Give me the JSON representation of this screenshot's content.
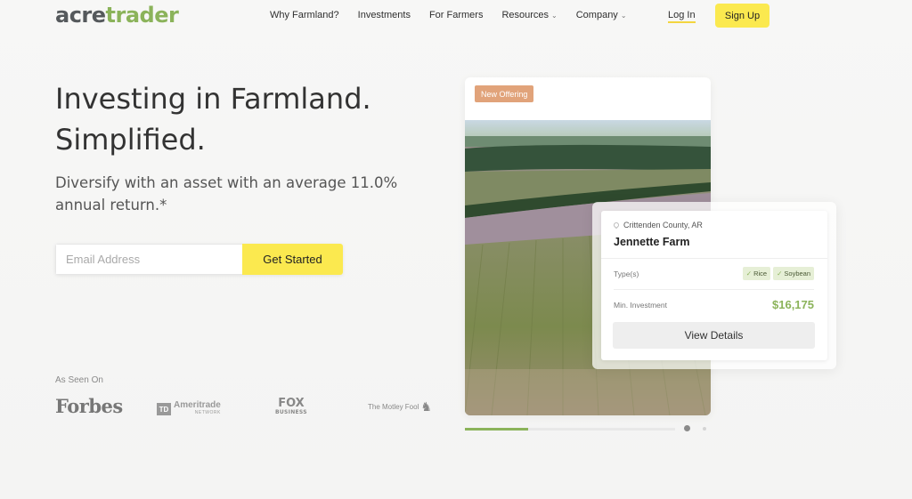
{
  "header": {
    "logo_part1": "acre",
    "logo_part2": "trader",
    "nav": [
      {
        "label": "Why Farmland?",
        "dropdown": false
      },
      {
        "label": "Investments",
        "dropdown": false
      },
      {
        "label": "For Farmers",
        "dropdown": false
      },
      {
        "label": "Resources",
        "dropdown": true
      },
      {
        "label": "Company",
        "dropdown": true
      }
    ],
    "login_label": "Log In",
    "signup_label": "Sign Up"
  },
  "hero": {
    "title_line1": "Investing in Farmland.",
    "title_line2": "Simplified.",
    "subtitle": "Diversify with an asset with an average 11.0% annual return.*",
    "email_placeholder": "Email Address",
    "cta_label": "Get Started"
  },
  "press": {
    "heading": "As Seen On",
    "forbes": "Forbes",
    "td_badge": "TD",
    "td_name": "Ameritrade",
    "td_sub": "NETWORK",
    "fox_line1": "FOX",
    "fox_line2": "BUSINESS",
    "motley": "The Motley Fool"
  },
  "offering": {
    "badge": "New Offering",
    "carousel_progress": 0.3,
    "farm": {
      "location": "Crittenden County, AR",
      "name": "Jennette Farm",
      "types_label": "Type(s)",
      "types": [
        "Rice",
        "Soybean"
      ],
      "min_investment_label": "Min. Investment",
      "min_investment_value": "$16,175",
      "button_label": "View Details"
    }
  },
  "colors": {
    "accent_yellow": "#fbe94f",
    "brand_green": "#8bb35a",
    "badge_orange": "#e1a37a"
  }
}
